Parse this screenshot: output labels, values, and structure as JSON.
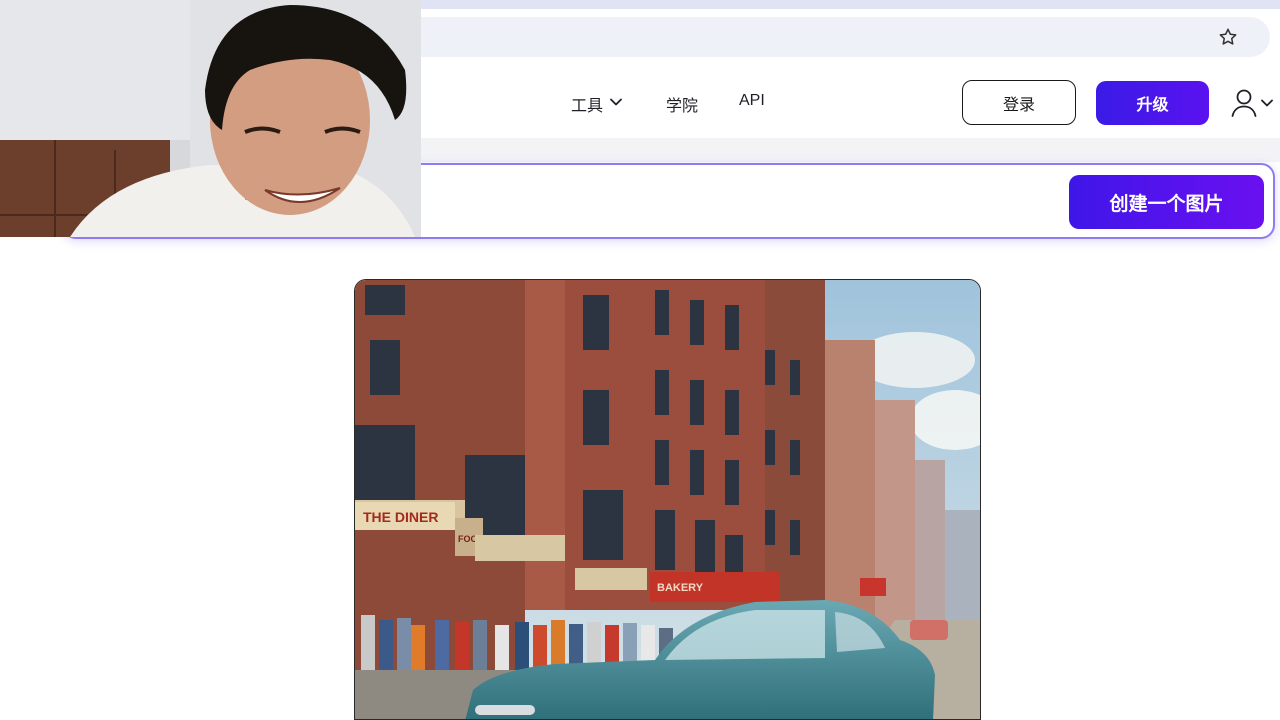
{
  "nav": {
    "tools_label": "工具",
    "academy_label": "学院",
    "api_label": "API"
  },
  "header": {
    "login_label": "登录",
    "upgrade_label": "升级"
  },
  "prompt": {
    "value": "",
    "create_label": "创建一个图片"
  },
  "image": {
    "storefront_sign_1": "THE DINER",
    "storefront_sign_2": "FOOD",
    "storefront_sign_3": "BAKERY"
  },
  "colors": {
    "accent": "#4a14ee",
    "prompt_border": "#8f7bf2"
  },
  "icons": {
    "bookmark": "star-icon",
    "tools_dropdown": "chevron-down-icon",
    "user": "user-icon"
  }
}
